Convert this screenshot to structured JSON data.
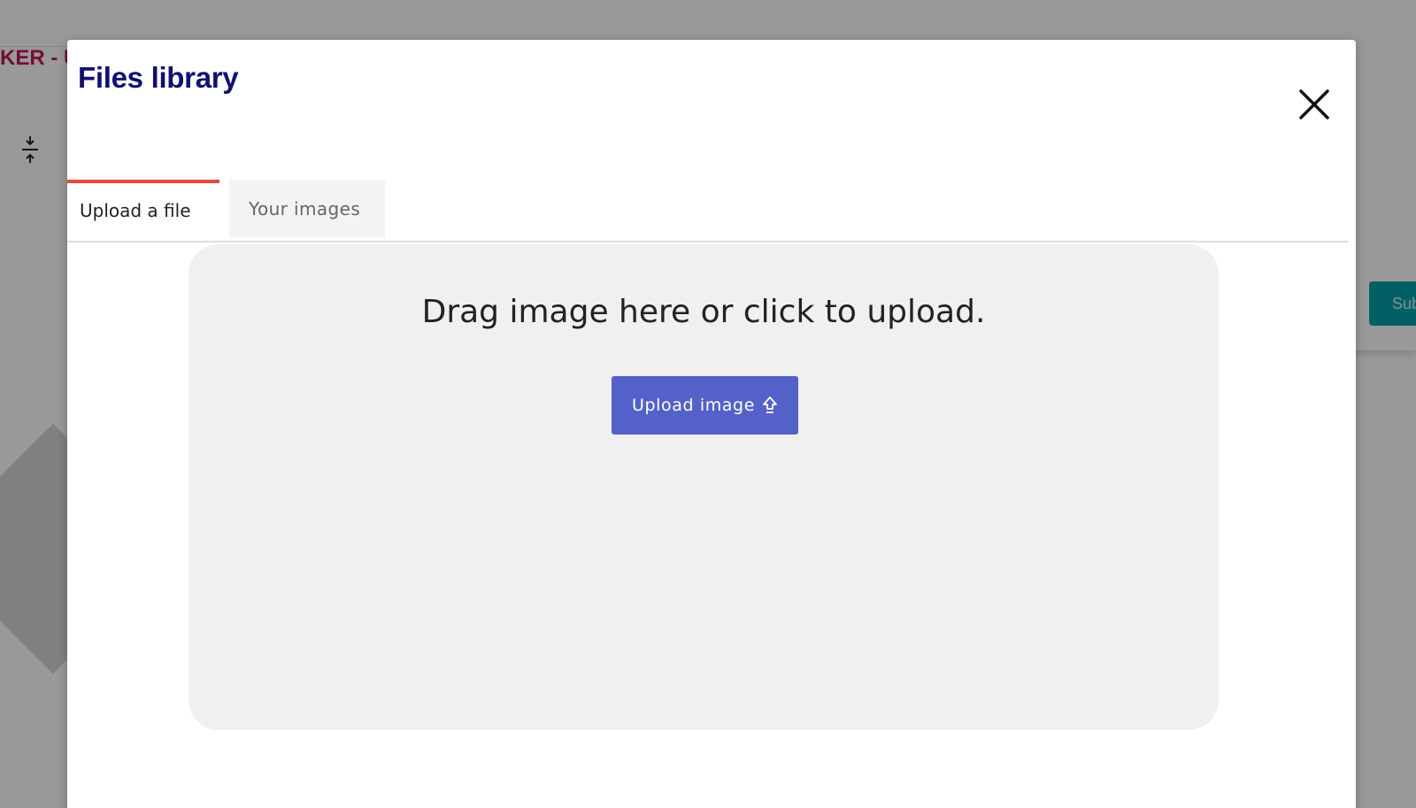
{
  "background": {
    "brand_text": "KER - U",
    "submit_label": "Sub"
  },
  "modal": {
    "title": "Files library",
    "close_icon": "close-icon",
    "tabs": [
      {
        "label": "Upload a file",
        "active": true
      },
      {
        "label": "Your images",
        "active": false
      }
    ],
    "dropzone": {
      "prompt": "Drag image here or click to upload.",
      "upload_button_label": "Upload image",
      "upload_icon": "upload-arrow-icon"
    }
  },
  "colors": {
    "title": "#12106e",
    "active_tab_indicator": "#e8493d",
    "upload_button": "#5461c8",
    "dropzone_bg": "#f0f0f0",
    "brand": "#c2185b",
    "submit_button": "#00a0a8"
  }
}
